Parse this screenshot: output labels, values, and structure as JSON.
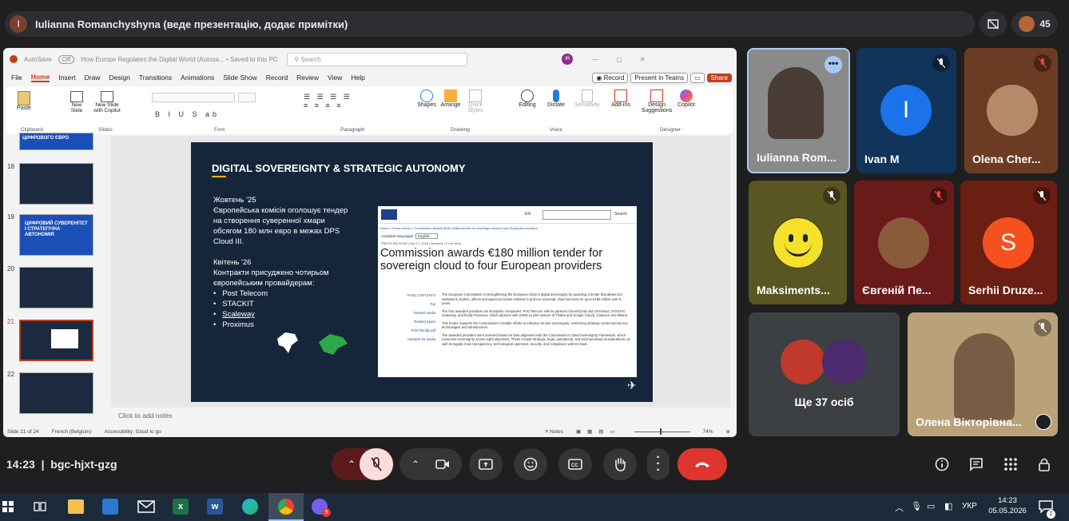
{
  "meeting": {
    "presenter_initial": "I",
    "presenter_banner": "Iulianna Romanchyshyna (веде презентацію, додає примітки)",
    "participant_count": "45",
    "clock": "14:23",
    "meeting_code": "bgc-hjxt-gzg"
  },
  "ppt": {
    "autosave": "AutoSave",
    "autosave_state": "Off",
    "doc_title": "How Europe Regulates the Digital World (Autosa... • Saved to this PC",
    "search_placeholder": "Search",
    "user_initials": "IR",
    "menu": [
      "File",
      "Home",
      "Insert",
      "Draw",
      "Design",
      "Transitions",
      "Animations",
      "Slide Show",
      "Record",
      "Review",
      "View",
      "Help"
    ],
    "record_btn": "Record",
    "teams_btn": "Present in Teams",
    "share_btn": "Share",
    "ribbon": {
      "paste": "Paste",
      "new_slide": "New Slide",
      "new_slide_copilot": "New Slide with Copilot",
      "clipboard": "Clipboard",
      "slides": "Slides",
      "font": "Font",
      "paragraph": "Paragraph",
      "shapes": "Shapes",
      "arrange": "Arrange",
      "quick_styles": "Quick Styles",
      "drawing": "Drawing",
      "editing": "Editing",
      "dictate": "Dictate",
      "voice": "Voice",
      "sensitivity": "Sensitivity",
      "add_ins": "Add-ins",
      "designer": "Design Suggestions",
      "copilot": "Copilot",
      "designer_grp": "Designer"
    },
    "thumbnails": [
      {
        "num": "",
        "title": "ЦИФРОВОГО ЄВРО"
      },
      {
        "num": "18",
        "title": ""
      },
      {
        "num": "19",
        "title": "ЦИФРОВИЙ СУВЕРЕНІТЕТ І СТРАТЕГІЧНА АВТОНОМІЯ"
      },
      {
        "num": "20",
        "title": ""
      },
      {
        "num": "21",
        "title": ""
      },
      {
        "num": "22",
        "title": ""
      }
    ],
    "slide": {
      "title": "DIGITAL SOVEREIGNTY & STRATEGIC AUTONOMY",
      "p1_head": "Жовтень '25",
      "p1_body": [
        "Європейська комісія оголошує тендер",
        "на створення суверенної хмари",
        "обсягом 180 млн евро в межах DPS",
        "Cloud III."
      ],
      "p2_head": "Квітень '26",
      "p2_body": [
        "Контракти присуджено чотирьом",
        "європейським провайдерам:"
      ],
      "bullets": [
        "Post Telecom",
        "STACKIT",
        "Scaleway",
        "Proximus"
      ],
      "shot_headline": "Commission awards €180 million tender for sovereign cloud to four European providers",
      "shot_meta": "PRESS RELEASE | Apr 17, 2026 | Brussels | 2 min read",
      "shot_lang": "Available languages:",
      "shot_lang_val": "English",
      "shot_search": "Search",
      "shot_en": "EN",
      "shot_crumbs": "Home > Press corner > Commission awards €180 million tender for sovereign cloud to four European providers",
      "shot_side": [
        "PAGE CONTENTS",
        "Top",
        "Related media",
        "Related topics",
        "Print friendly pdf",
        "Contacts for media"
      ],
      "shot_p1": "The European Commission is strengthening the European Union's digital sovereignty by awarding a tender that allows EU institutions, bodies, offices and agencies (Union entities) to procure sovereign cloud services for up to €180 million over 6 years.",
      "shot_p2": "The four awarded providers are European companies: Post Telecom with its partners CleverCloud and OVHcloud, STACKIT, Scaleway, and finally Proximus, which partners with S3NS (a joint venture of Thales and Google Cloud), Clarence and Mistral.",
      "shot_p3": "This tender supports the Commission's broader efforts to enhance its own sovereignty, reinforcing strategic control across key technologies and infrastructure.",
      "shot_p4": "The awarded providers were selected based on their alignment with the Commission's Cloud Sovereignty Framework, which measures sovereignty across eight objectives. These include strategic, legal, operational, and environmental considerations, as well as supply chain transparency, technological openness, security, and compliance with EU laws."
    },
    "notes_placeholder": "Click to add notes",
    "status_slide": "Slide 21 of 24",
    "status_lang": "French (Belgium)",
    "status_access": "Accessibility: Good to go",
    "status_notes": "Notes",
    "zoom": "74%"
  },
  "tiles": [
    {
      "name": "Iulianna Rom..."
    },
    {
      "name": "Ivan M",
      "initial": "I"
    },
    {
      "name": "Olena Cher..."
    },
    {
      "name": "Maksiments..."
    },
    {
      "name": "Євгеній Пе..."
    },
    {
      "name": "Serhii Druze...",
      "initial": "S"
    },
    {
      "name": "Ще 37 осіб"
    },
    {
      "name": "Олена Вікторівна..."
    }
  ],
  "taskbar": {
    "lang": "УКР",
    "time": "14:23",
    "date": "05.05.2026",
    "notif_count": "2",
    "viber_badge": "5"
  },
  "colors": {
    "accent_red": "#ea4335",
    "ppt_orange": "#c43e1c",
    "tile_blue": "#1a73e8",
    "slide_bg": "#15263b"
  }
}
